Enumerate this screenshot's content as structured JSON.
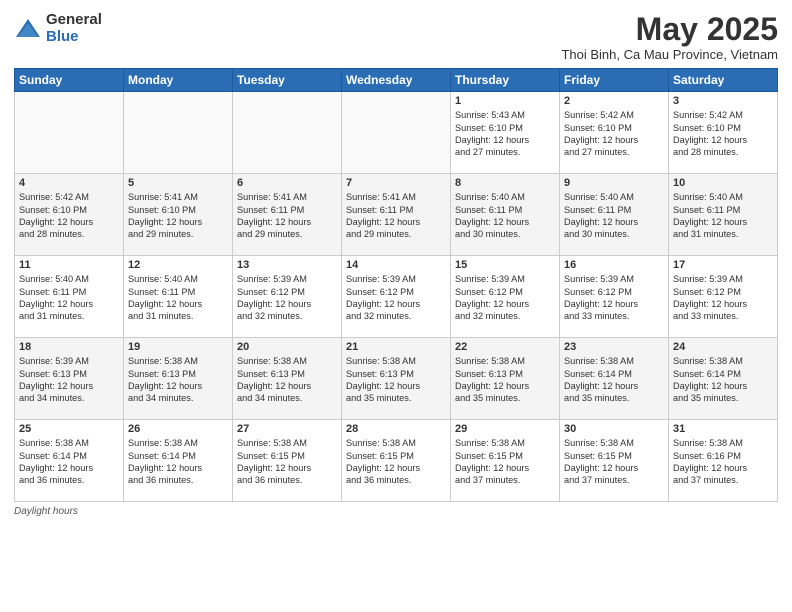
{
  "header": {
    "logo_general": "General",
    "logo_blue": "Blue",
    "title": "May 2025",
    "location": "Thoi Binh, Ca Mau Province, Vietnam"
  },
  "days_of_week": [
    "Sunday",
    "Monday",
    "Tuesday",
    "Wednesday",
    "Thursday",
    "Friday",
    "Saturday"
  ],
  "weeks": [
    [
      {
        "day": "",
        "info": ""
      },
      {
        "day": "",
        "info": ""
      },
      {
        "day": "",
        "info": ""
      },
      {
        "day": "",
        "info": ""
      },
      {
        "day": "1",
        "info": "Sunrise: 5:43 AM\nSunset: 6:10 PM\nDaylight: 12 hours\nand 27 minutes."
      },
      {
        "day": "2",
        "info": "Sunrise: 5:42 AM\nSunset: 6:10 PM\nDaylight: 12 hours\nand 27 minutes."
      },
      {
        "day": "3",
        "info": "Sunrise: 5:42 AM\nSunset: 6:10 PM\nDaylight: 12 hours\nand 28 minutes."
      }
    ],
    [
      {
        "day": "4",
        "info": "Sunrise: 5:42 AM\nSunset: 6:10 PM\nDaylight: 12 hours\nand 28 minutes."
      },
      {
        "day": "5",
        "info": "Sunrise: 5:41 AM\nSunset: 6:10 PM\nDaylight: 12 hours\nand 29 minutes."
      },
      {
        "day": "6",
        "info": "Sunrise: 5:41 AM\nSunset: 6:11 PM\nDaylight: 12 hours\nand 29 minutes."
      },
      {
        "day": "7",
        "info": "Sunrise: 5:41 AM\nSunset: 6:11 PM\nDaylight: 12 hours\nand 29 minutes."
      },
      {
        "day": "8",
        "info": "Sunrise: 5:40 AM\nSunset: 6:11 PM\nDaylight: 12 hours\nand 30 minutes."
      },
      {
        "day": "9",
        "info": "Sunrise: 5:40 AM\nSunset: 6:11 PM\nDaylight: 12 hours\nand 30 minutes."
      },
      {
        "day": "10",
        "info": "Sunrise: 5:40 AM\nSunset: 6:11 PM\nDaylight: 12 hours\nand 31 minutes."
      }
    ],
    [
      {
        "day": "11",
        "info": "Sunrise: 5:40 AM\nSunset: 6:11 PM\nDaylight: 12 hours\nand 31 minutes."
      },
      {
        "day": "12",
        "info": "Sunrise: 5:40 AM\nSunset: 6:11 PM\nDaylight: 12 hours\nand 31 minutes."
      },
      {
        "day": "13",
        "info": "Sunrise: 5:39 AM\nSunset: 6:12 PM\nDaylight: 12 hours\nand 32 minutes."
      },
      {
        "day": "14",
        "info": "Sunrise: 5:39 AM\nSunset: 6:12 PM\nDaylight: 12 hours\nand 32 minutes."
      },
      {
        "day": "15",
        "info": "Sunrise: 5:39 AM\nSunset: 6:12 PM\nDaylight: 12 hours\nand 32 minutes."
      },
      {
        "day": "16",
        "info": "Sunrise: 5:39 AM\nSunset: 6:12 PM\nDaylight: 12 hours\nand 33 minutes."
      },
      {
        "day": "17",
        "info": "Sunrise: 5:39 AM\nSunset: 6:12 PM\nDaylight: 12 hours\nand 33 minutes."
      }
    ],
    [
      {
        "day": "18",
        "info": "Sunrise: 5:39 AM\nSunset: 6:13 PM\nDaylight: 12 hours\nand 34 minutes."
      },
      {
        "day": "19",
        "info": "Sunrise: 5:38 AM\nSunset: 6:13 PM\nDaylight: 12 hours\nand 34 minutes."
      },
      {
        "day": "20",
        "info": "Sunrise: 5:38 AM\nSunset: 6:13 PM\nDaylight: 12 hours\nand 34 minutes."
      },
      {
        "day": "21",
        "info": "Sunrise: 5:38 AM\nSunset: 6:13 PM\nDaylight: 12 hours\nand 35 minutes."
      },
      {
        "day": "22",
        "info": "Sunrise: 5:38 AM\nSunset: 6:13 PM\nDaylight: 12 hours\nand 35 minutes."
      },
      {
        "day": "23",
        "info": "Sunrise: 5:38 AM\nSunset: 6:14 PM\nDaylight: 12 hours\nand 35 minutes."
      },
      {
        "day": "24",
        "info": "Sunrise: 5:38 AM\nSunset: 6:14 PM\nDaylight: 12 hours\nand 35 minutes."
      }
    ],
    [
      {
        "day": "25",
        "info": "Sunrise: 5:38 AM\nSunset: 6:14 PM\nDaylight: 12 hours\nand 36 minutes."
      },
      {
        "day": "26",
        "info": "Sunrise: 5:38 AM\nSunset: 6:14 PM\nDaylight: 12 hours\nand 36 minutes."
      },
      {
        "day": "27",
        "info": "Sunrise: 5:38 AM\nSunset: 6:15 PM\nDaylight: 12 hours\nand 36 minutes."
      },
      {
        "day": "28",
        "info": "Sunrise: 5:38 AM\nSunset: 6:15 PM\nDaylight: 12 hours\nand 36 minutes."
      },
      {
        "day": "29",
        "info": "Sunrise: 5:38 AM\nSunset: 6:15 PM\nDaylight: 12 hours\nand 37 minutes."
      },
      {
        "day": "30",
        "info": "Sunrise: 5:38 AM\nSunset: 6:15 PM\nDaylight: 12 hours\nand 37 minutes."
      },
      {
        "day": "31",
        "info": "Sunrise: 5:38 AM\nSunset: 6:16 PM\nDaylight: 12 hours\nand 37 minutes."
      }
    ]
  ],
  "footer": {
    "label": "Daylight hours"
  }
}
